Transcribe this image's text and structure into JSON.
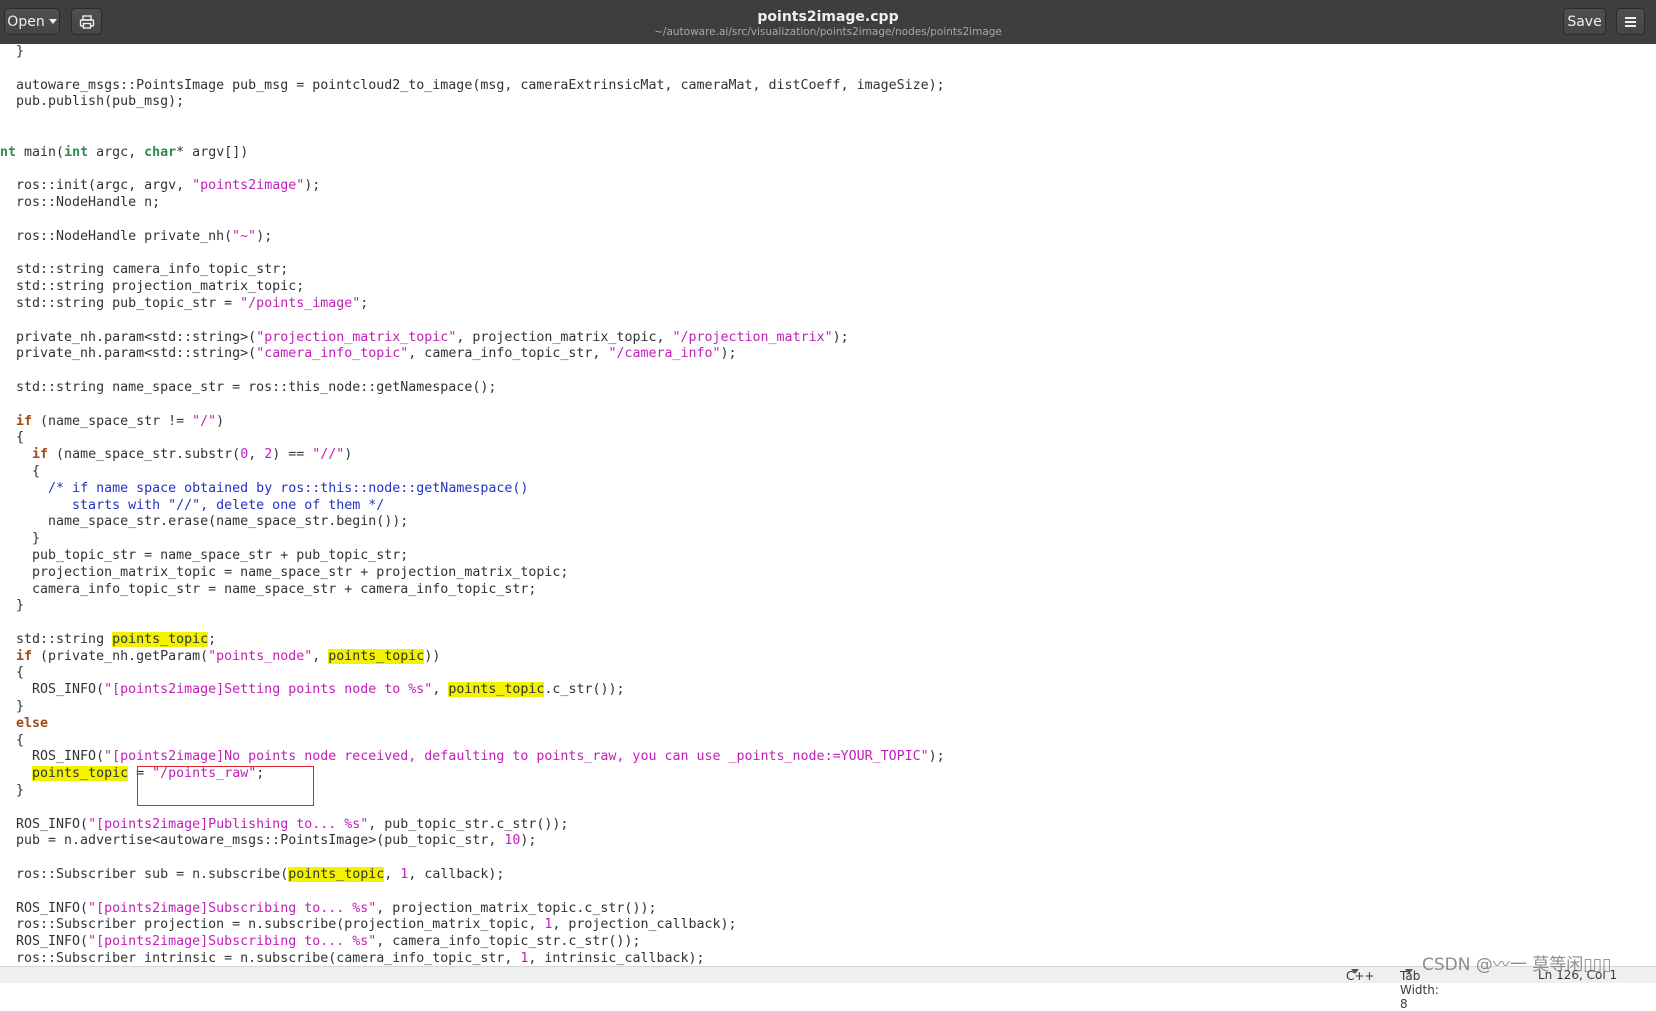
{
  "window": {
    "title": "points2image.cpp",
    "path": "~/autoware.ai/src/visualization/points2image/nodes/points2image"
  },
  "toolbar": {
    "open_label": "Open",
    "save_label": "Save",
    "print_icon": "printer-icon",
    "menu_icon": "hamburger-menu-icon",
    "open_icon": "caret-down-icon"
  },
  "status": {
    "language": "C++",
    "tab_width": "Tab Width: 8",
    "position": "Ln 126, Col 1"
  },
  "watermark": "CSDN @〰一 莫等闲▯▯▯",
  "highlight_color": "#f5f200",
  "code_lines": [
    [
      [
        "p",
        "  }"
      ]
    ],
    [
      [
        "p",
        ""
      ]
    ],
    [
      [
        "p",
        "  autoware_msgs::PointsImage pub_msg = pointcloud2_to_image(msg, cameraExtrinsicMat, cameraMat, distCoeff, imageSize);"
      ]
    ],
    [
      [
        "p",
        "  pub.publish(pub_msg);"
      ]
    ],
    [
      [
        "p",
        ""
      ]
    ],
    [
      [
        "p",
        ""
      ]
    ],
    [
      [
        "k",
        "nt"
      ],
      [
        "p",
        " main("
      ],
      [
        "k",
        "int"
      ],
      [
        "p",
        " argc, "
      ],
      [
        "k",
        "char"
      ],
      [
        "p",
        "* argv[])"
      ]
    ],
    [
      [
        "p",
        ""
      ]
    ],
    [
      [
        "p",
        "  ros::init(argc, argv, "
      ],
      [
        "s",
        "\"points2image\""
      ],
      [
        "p",
        ");"
      ]
    ],
    [
      [
        "p",
        "  ros::NodeHandle n;"
      ]
    ],
    [
      [
        "p",
        ""
      ]
    ],
    [
      [
        "p",
        "  ros::NodeHandle private_nh("
      ],
      [
        "s",
        "\"~\""
      ],
      [
        "p",
        ");"
      ]
    ],
    [
      [
        "p",
        ""
      ]
    ],
    [
      [
        "p",
        "  std::string camera_info_topic_str;"
      ]
    ],
    [
      [
        "p",
        "  std::string projection_matrix_topic;"
      ]
    ],
    [
      [
        "p",
        "  std::string pub_topic_str = "
      ],
      [
        "s",
        "\"/points_image\""
      ],
      [
        "p",
        ";"
      ]
    ],
    [
      [
        "p",
        ""
      ]
    ],
    [
      [
        "p",
        "  private_nh.param<std::string>("
      ],
      [
        "s",
        "\"projection_matrix_topic\""
      ],
      [
        "p",
        ", projection_matrix_topic, "
      ],
      [
        "s",
        "\"/projection_matrix\""
      ],
      [
        "p",
        ");"
      ]
    ],
    [
      [
        "p",
        "  private_nh.param<std::string>("
      ],
      [
        "s",
        "\"camera_info_topic\""
      ],
      [
        "p",
        ", camera_info_topic_str, "
      ],
      [
        "s",
        "\"/camera_info\""
      ],
      [
        "p",
        ");"
      ]
    ],
    [
      [
        "p",
        ""
      ]
    ],
    [
      [
        "p",
        "  std::string name_space_str = ros::this_node::getNamespace();"
      ]
    ],
    [
      [
        "p",
        ""
      ]
    ],
    [
      [
        "p",
        "  "
      ],
      [
        "o",
        "if"
      ],
      [
        "p",
        " (name_space_str != "
      ],
      [
        "s",
        "\"/\""
      ],
      [
        "p",
        ")"
      ]
    ],
    [
      [
        "p",
        "  {"
      ]
    ],
    [
      [
        "p",
        "    "
      ],
      [
        "o",
        "if"
      ],
      [
        "p",
        " (name_space_str.substr("
      ],
      [
        "n",
        "0"
      ],
      [
        "p",
        ", "
      ],
      [
        "n",
        "2"
      ],
      [
        "p",
        ") == "
      ],
      [
        "s",
        "\"//\""
      ],
      [
        "p",
        ")"
      ]
    ],
    [
      [
        "p",
        "    {"
      ]
    ],
    [
      [
        "p",
        "      "
      ],
      [
        "c",
        "/* if name space obtained by ros::this::node::getNamespace()"
      ]
    ],
    [
      [
        "c",
        "         starts with \"//\", delete one of them */"
      ]
    ],
    [
      [
        "p",
        "      name_space_str.erase(name_space_str.begin());"
      ]
    ],
    [
      [
        "p",
        "    }"
      ]
    ],
    [
      [
        "p",
        "    pub_topic_str = name_space_str + pub_topic_str;"
      ]
    ],
    [
      [
        "p",
        "    projection_matrix_topic = name_space_str + projection_matrix_topic;"
      ]
    ],
    [
      [
        "p",
        "    camera_info_topic_str = name_space_str + camera_info_topic_str;"
      ]
    ],
    [
      [
        "p",
        "  }"
      ]
    ],
    [
      [
        "p",
        ""
      ]
    ],
    [
      [
        "p",
        "  std::string "
      ],
      [
        "h",
        "points_topic"
      ],
      [
        "p",
        ";"
      ]
    ],
    [
      [
        "p",
        "  "
      ],
      [
        "o",
        "if"
      ],
      [
        "p",
        " (private_nh.getParam("
      ],
      [
        "s",
        "\"points_node\""
      ],
      [
        "p",
        ", "
      ],
      [
        "h",
        "points_topic"
      ],
      [
        "p",
        "))"
      ]
    ],
    [
      [
        "p",
        "  {"
      ]
    ],
    [
      [
        "p",
        "    ROS_INFO("
      ],
      [
        "s",
        "\"[points2image]Setting points node to "
      ],
      [
        "s",
        "%s\""
      ],
      [
        "p",
        ", "
      ],
      [
        "h",
        "points_topic"
      ],
      [
        "p",
        ".c_str());"
      ]
    ],
    [
      [
        "p",
        "  }"
      ]
    ],
    [
      [
        "p",
        "  "
      ],
      [
        "o",
        "else"
      ]
    ],
    [
      [
        "p",
        "  {"
      ]
    ],
    [
      [
        "p",
        "    ROS_INFO("
      ],
      [
        "s",
        "\"[points2image]No points node received, defaulting to points_raw, you can use _points_node:=YOUR_TOPIC\""
      ],
      [
        "p",
        ");"
      ]
    ],
    [
      [
        "p",
        "    "
      ],
      [
        "h",
        "points_topic"
      ],
      [
        "p",
        " = "
      ],
      [
        "s",
        "\"/points_raw\""
      ],
      [
        "p",
        ";"
      ]
    ],
    [
      [
        "p",
        "  }"
      ]
    ],
    [
      [
        "p",
        ""
      ]
    ],
    [
      [
        "p",
        "  ROS_INFO("
      ],
      [
        "s",
        "\"[points2image]Publishing to... %s\""
      ],
      [
        "p",
        ", pub_topic_str.c_str());"
      ]
    ],
    [
      [
        "p",
        "  pub = n.advertise<autoware_msgs::PointsImage>(pub_topic_str, "
      ],
      [
        "n",
        "10"
      ],
      [
        "p",
        ");"
      ]
    ],
    [
      [
        "p",
        ""
      ]
    ],
    [
      [
        "p",
        "  ros::Subscriber sub = n.subscribe("
      ],
      [
        "h",
        "points_topic"
      ],
      [
        "p",
        ", "
      ],
      [
        "n",
        "1"
      ],
      [
        "p",
        ", callback);"
      ]
    ],
    [
      [
        "p",
        ""
      ]
    ],
    [
      [
        "p",
        "  ROS_INFO("
      ],
      [
        "s",
        "\"[points2image]Subscribing to... %s\""
      ],
      [
        "p",
        ", projection_matrix_topic.c_str());"
      ]
    ],
    [
      [
        "p",
        "  ros::Subscriber projection = n.subscribe(projection_matrix_topic, "
      ],
      [
        "n",
        "1"
      ],
      [
        "p",
        ", projection_callback);"
      ]
    ],
    [
      [
        "p",
        "  ROS_INFO("
      ],
      [
        "s",
        "\"[points2image]Subscribing to... %s\""
      ],
      [
        "p",
        ", camera_info_topic_str.c_str());"
      ]
    ],
    [
      [
        "p",
        "  ros::Subscriber intrinsic = n.subscribe(camera_info_topic_str, "
      ],
      [
        "n",
        "1"
      ],
      [
        "p",
        ", intrinsic_callback);"
      ]
    ]
  ]
}
